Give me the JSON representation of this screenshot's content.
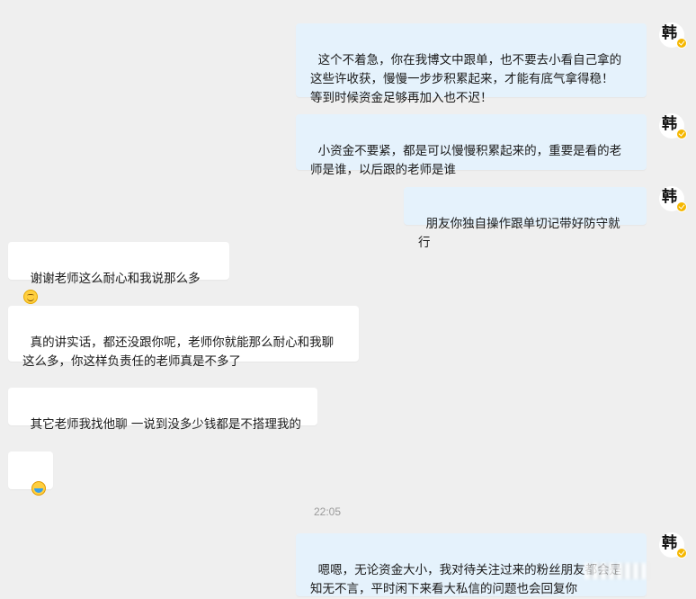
{
  "messages": [
    {
      "side": "out",
      "text": "这个不着急，你在我博文中跟单，也不要去小看自己拿的\n这些许收获，慢慢一步步积累起来，才能有底气拿得稳！\n等到时候资金足够再加入也不迟！"
    },
    {
      "side": "out",
      "text": "小资金不要紧，都是可以慢慢积累起来的，重要是看的老\n师是谁，以后跟的老师是谁"
    },
    {
      "side": "out",
      "text": "朋友你独自操作跟单切记带好防守就行"
    },
    {
      "side": "in",
      "text": "谢谢老师这么耐心和我说那么多"
    },
    {
      "side": "in",
      "text": "真的讲实话，都还没跟你呢，老师你就能那么耐心和我聊\n这么多，你这样负责任的老师真是不多了"
    },
    {
      "side": "in",
      "text": "其它老师我找他聊 一说到没多少钱都是不搭理我的"
    },
    {
      "side": "in",
      "text": ""
    },
    {
      "side": "out",
      "text": "嗯嗯，无论资金大小，我对待关注过来的粉丝朋友都会是\n知无不言，平时闲下来看大私信的问题也会回复你"
    }
  ],
  "timestamp": "22:05",
  "avatar": {
    "glyph": "韩",
    "badge_color": "#f5b700"
  },
  "icons": {
    "smile": "smiling-face-icon",
    "sticker": "sticker-icon"
  },
  "colors": {
    "outgoing_bubble": "#e5f2fc",
    "incoming_bubble": "#ffffff",
    "background": "#efefef"
  }
}
